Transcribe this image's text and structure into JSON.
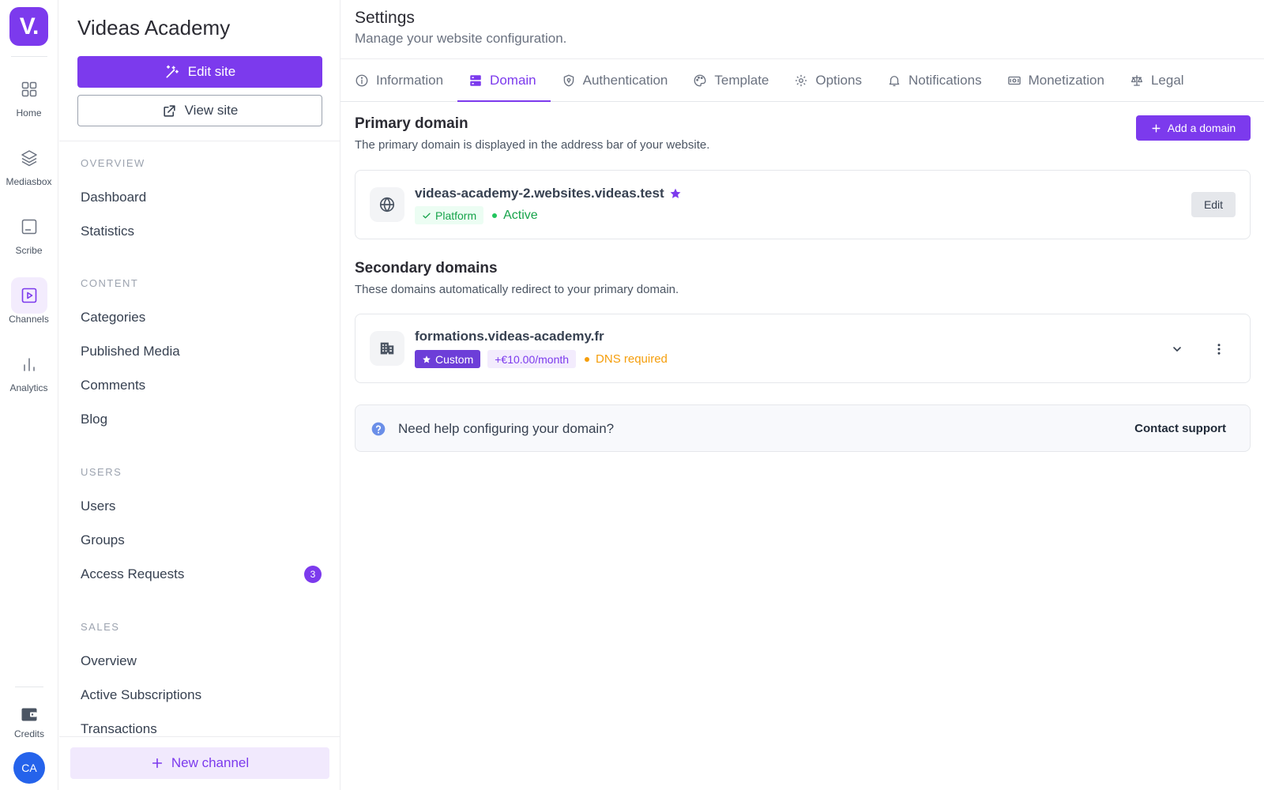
{
  "brand": {
    "logo": "V."
  },
  "rail": {
    "items": [
      {
        "label": "Home",
        "icon": "grid-icon"
      },
      {
        "label": "Mediasbox",
        "icon": "layers-icon"
      },
      {
        "label": "Scribe",
        "icon": "document-icon"
      },
      {
        "label": "Channels",
        "icon": "play-icon",
        "active": true
      },
      {
        "label": "Analytics",
        "icon": "bar-chart-icon"
      }
    ],
    "credits_label": "Credits",
    "avatar_initials": "CA"
  },
  "sidebar": {
    "site_title": "Videas Academy",
    "edit_site_label": "Edit site",
    "view_site_label": "View site",
    "sections": {
      "overview": {
        "title": "OVERVIEW",
        "items": [
          "Dashboard",
          "Statistics"
        ]
      },
      "content": {
        "title": "CONTENT",
        "items": [
          "Categories",
          "Published Media",
          "Comments",
          "Blog"
        ]
      },
      "users": {
        "title": "USERS",
        "items": [
          "Users",
          "Groups",
          "Access Requests"
        ],
        "access_requests_count": "3"
      },
      "sales": {
        "title": "SALES",
        "items": [
          "Overview",
          "Active Subscriptions",
          "Transactions"
        ]
      }
    },
    "new_channel_label": "New channel"
  },
  "main": {
    "title": "Settings",
    "subtitle": "Manage your website configuration.",
    "tabs": [
      {
        "label": "Information",
        "icon": "info-icon"
      },
      {
        "label": "Domain",
        "icon": "server-icon",
        "active": true
      },
      {
        "label": "Authentication",
        "icon": "shield-icon"
      },
      {
        "label": "Template",
        "icon": "palette-icon"
      },
      {
        "label": "Options",
        "icon": "gear-icon"
      },
      {
        "label": "Notifications",
        "icon": "bell-icon"
      },
      {
        "label": "Monetization",
        "icon": "money-icon"
      },
      {
        "label": "Legal",
        "icon": "scale-icon"
      }
    ],
    "primary": {
      "title": "Primary domain",
      "description": "The primary domain is displayed in the address bar of your website.",
      "add_label": "Add a domain",
      "domain": {
        "host": "videas-academy-2.websites.videas.test",
        "tag": "Platform",
        "status": "Active",
        "edit_label": "Edit"
      }
    },
    "secondary": {
      "title": "Secondary domains",
      "description": "These domains automatically redirect to your primary domain.",
      "domain": {
        "host": "formations.videas-academy.fr",
        "tag": "Custom",
        "price": "+€10.00/month",
        "status": "DNS required"
      }
    },
    "help": {
      "text": "Need help configuring your domain?",
      "link": "Contact support"
    }
  },
  "colors": {
    "accent": "#7c3aed",
    "active_green": "#16a34a",
    "warning": "#f59e0b"
  }
}
